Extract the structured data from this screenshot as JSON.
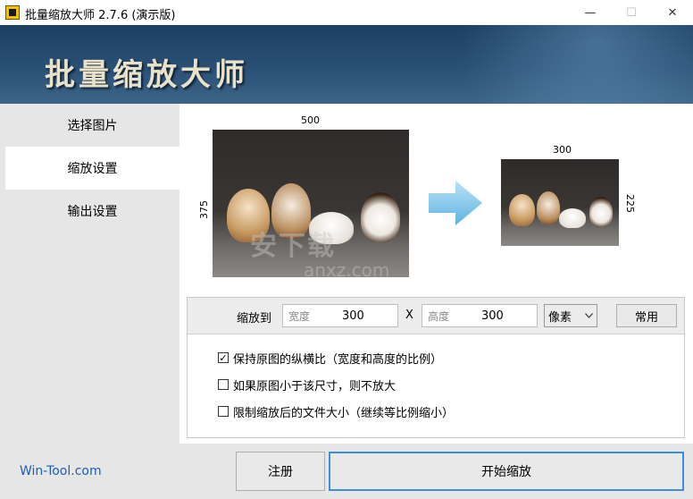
{
  "window": {
    "title": "批量缩放大师 2.7.6 (演示版)",
    "minimize_glyph": "—",
    "maximize_glyph": "☐",
    "close_glyph": "✕"
  },
  "banner": {
    "title": "批量缩放大师"
  },
  "sidebar": {
    "items": [
      {
        "label": "选择图片",
        "selected": false
      },
      {
        "label": "缩放设置",
        "selected": true
      },
      {
        "label": "输出设置",
        "selected": false
      }
    ]
  },
  "preview": {
    "source_width": "500",
    "source_height": "375",
    "target_width": "300",
    "target_height": "225",
    "watermark": "安下载",
    "watermark_sub": "anxz.com"
  },
  "scale": {
    "label": "缩放到",
    "width_placeholder": "宽度",
    "width_value": "300",
    "separator": "X",
    "height_placeholder": "高度",
    "height_value": "300",
    "unit": "像素",
    "common_button": "常用"
  },
  "options": [
    {
      "label": "保持原图的纵横比（宽度和高度的比例）",
      "checked": true
    },
    {
      "label": "如果原图小于该尺寸，则不放大",
      "checked": false
    },
    {
      "label": "限制缩放后的文件大小（继续等比例缩小）",
      "checked": false
    }
  ],
  "footer": {
    "site": "Win-Tool.com",
    "register_button": "注册",
    "start_button": "开始缩放"
  },
  "colors": {
    "banner": "#2a5075",
    "accent": "#3c8ee0",
    "link": "#1a5fb4",
    "sidebar": "#e6e6e6"
  }
}
